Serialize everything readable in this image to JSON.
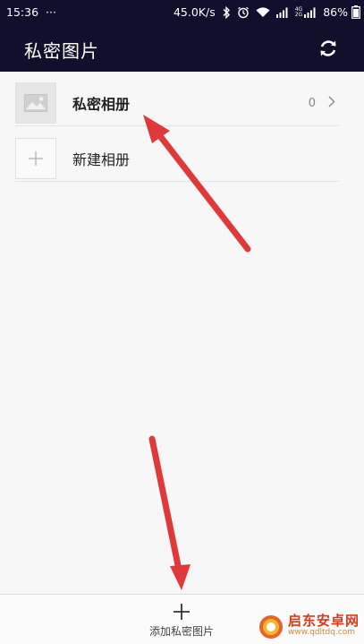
{
  "status_bar": {
    "time": "15:36",
    "dots": "···",
    "speed": "45.0K/s",
    "net_top": "4G",
    "net_bottom": "2G",
    "battery": "86%"
  },
  "app_bar": {
    "title": "私密图片",
    "refresh_icon": "refresh-icon"
  },
  "albums": [
    {
      "label": "私密相册",
      "count": "0",
      "icon": "image-icon"
    },
    {
      "label": "新建相册",
      "icon": "plus-icon"
    }
  ],
  "bottom_bar": {
    "add_label": "添加私密图片"
  },
  "watermark": {
    "brand": "启东安卓网",
    "url": "www.qdltdq.com"
  },
  "colors": {
    "header_bg": "#10102c",
    "content_bg": "#f7f7f7",
    "annotation_arrow": "#e0393a"
  }
}
